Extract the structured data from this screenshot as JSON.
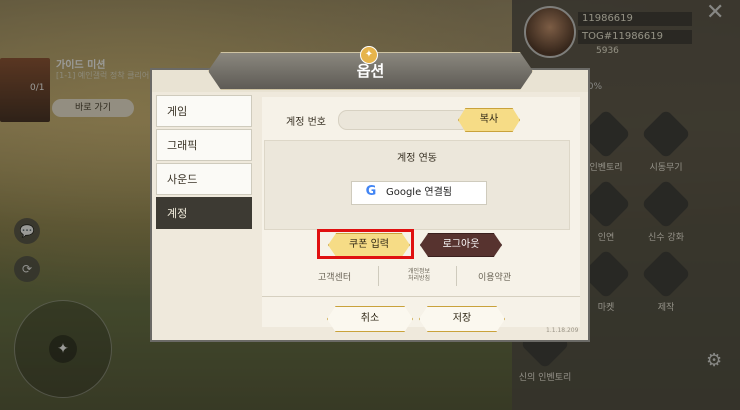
{
  "hud": {
    "guide_title": "가이드 미션",
    "guide_desc": "[1-1] 예인갤럭 정착 클리어",
    "guide_count": "0/1",
    "guide_button": "바로 가기",
    "uid": "11986619",
    "tog": "TOG#11986619",
    "gold": "5936",
    "percent": "00%",
    "side_chat": "💬",
    "side_sync": "⟳",
    "joystick_center": "✦",
    "menu": [
      {
        "label": "인벤토리"
      },
      {
        "label": "시동무기"
      },
      {
        "label": "인연"
      },
      {
        "label": "신수 강화"
      },
      {
        "label": "마켓"
      },
      {
        "label": "제작"
      },
      {
        "label": "신의 인벤토리"
      }
    ]
  },
  "dialog": {
    "title": "옵션",
    "ornament": "✦",
    "tabs": [
      "게임",
      "그래픽",
      "사운드",
      "계정"
    ],
    "active_tab": 3,
    "account_number_label": "계정 번호",
    "copy_button": "복사",
    "link_title": "계정 연동",
    "google_g": "G",
    "google_button": "Google 연결됨",
    "coupon_button": "쿠폰 입력",
    "logout_button": "로그아웃",
    "customer_center": "고객센터",
    "privacy_line1": "개인정보",
    "privacy_line2": "처리방침",
    "terms": "이용약관",
    "cancel_button": "취소",
    "save_button": "저장",
    "version": "1.1.18.209"
  }
}
